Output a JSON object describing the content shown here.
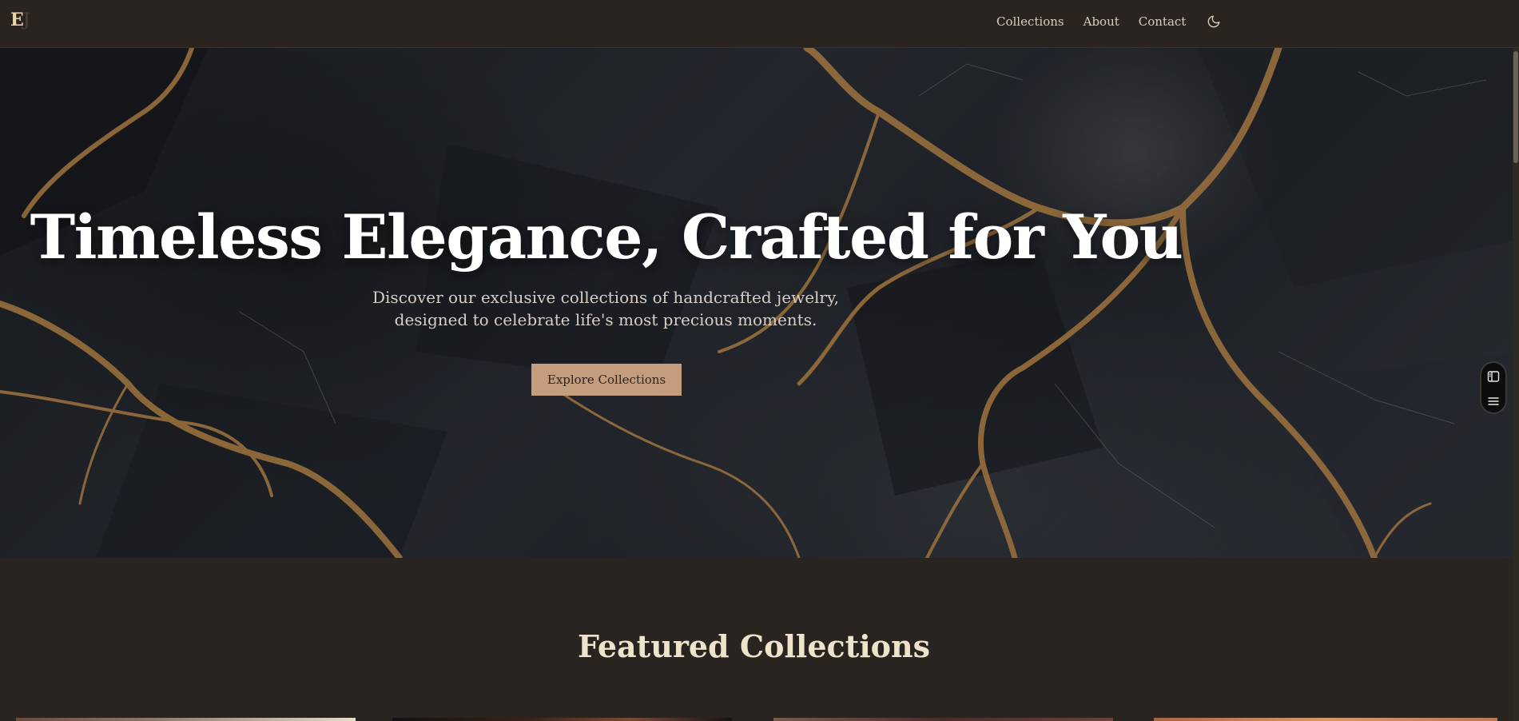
{
  "brand": {
    "logo_text": "E",
    "logo_tail": "J"
  },
  "nav": {
    "links": [
      {
        "label": "Collections"
      },
      {
        "label": "About"
      },
      {
        "label": "Contact"
      }
    ],
    "theme_toggle_icon": "moon-icon"
  },
  "hero": {
    "title": "Timeless Elegance, Crafted for You",
    "subtitle_line1": "Discover our exclusive collections of handcrafted jewelry,",
    "subtitle_line2": "designed to celebrate life's most precious moments.",
    "cta_label": "Explore Collections",
    "background_icon": "marble-texture"
  },
  "featured": {
    "title": "Featured Collections"
  },
  "side_widget": {
    "icons": [
      "sidebar-panel-icon",
      "menu-lines-icon"
    ]
  },
  "colors": {
    "page_bg": "#2a2420",
    "accent": "#c49d7c",
    "gold_vein": "#b8874a",
    "text_light": "#efe6d6"
  }
}
